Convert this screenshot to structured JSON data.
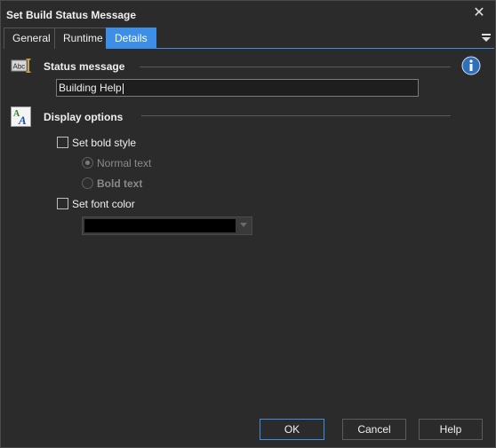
{
  "window": {
    "title": "Set Build Status Message"
  },
  "tabs": [
    {
      "label": "General",
      "active": false
    },
    {
      "label": "Runtime",
      "active": false
    },
    {
      "label": "Details",
      "active": true
    }
  ],
  "status_section": {
    "label": "Status message",
    "icon": "abc-text-icon",
    "value": "Building Help"
  },
  "display_section": {
    "label": "Display options",
    "icon": "font-aa-icon",
    "bold_checkbox_label": "Set bold style",
    "bold_checked": false,
    "normal_text_label": "Normal text",
    "bold_text_label": "Bold text",
    "selected_option": "Normal text",
    "font_color_label": "Set font color",
    "font_color_checked": false,
    "font_color_value": "#000000"
  },
  "buttons": {
    "ok": "OK",
    "cancel": "Cancel",
    "help": "Help"
  },
  "colors": {
    "accent": "#3d8ee6",
    "background": "#2b2b2b",
    "info_icon": "#2f6fb8"
  }
}
